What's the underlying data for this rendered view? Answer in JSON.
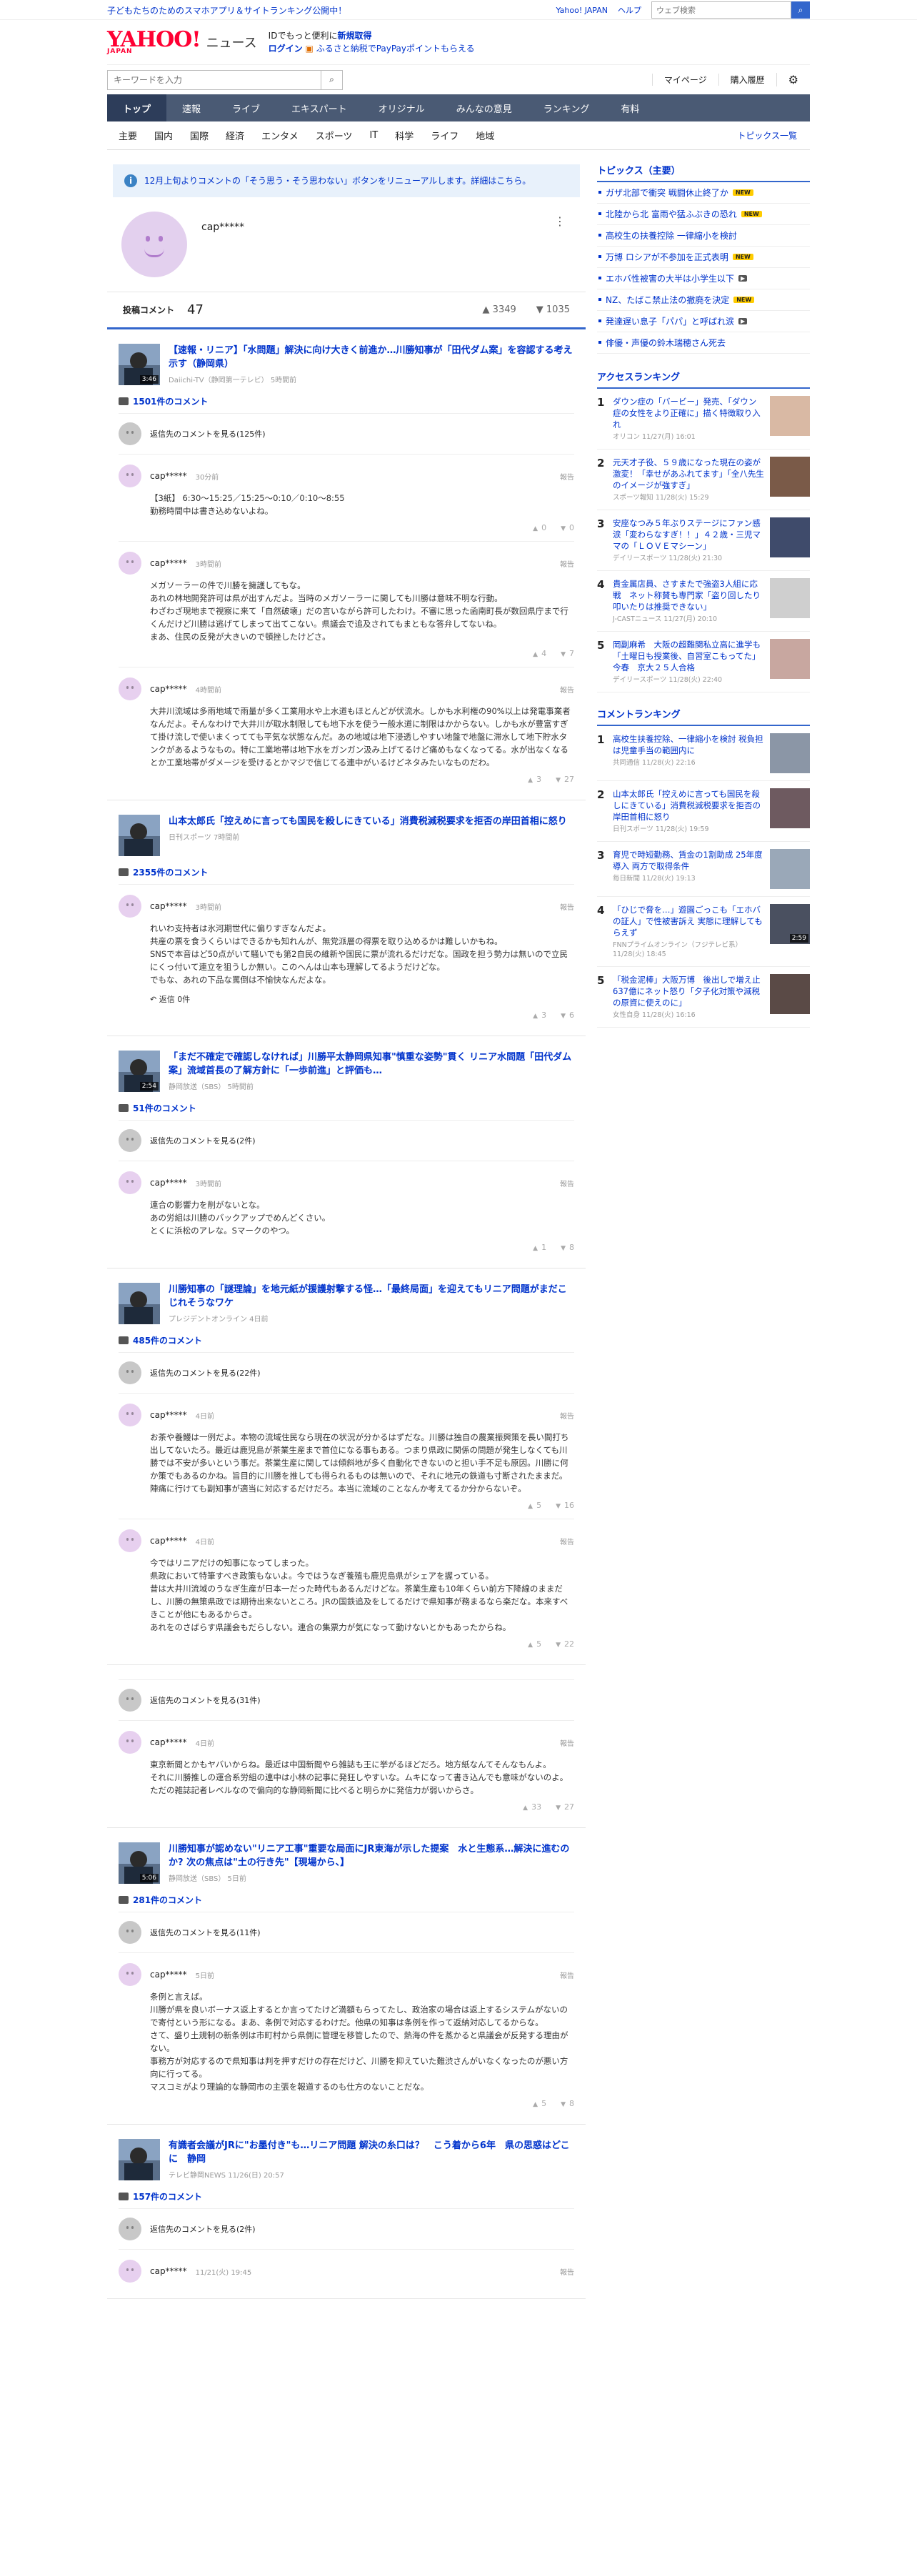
{
  "topbar": {
    "promo": "子どもたちのためのスマホアプリ＆サイトランキング公開中！",
    "links": [
      "Yahoo! JAPAN",
      "ヘルプ"
    ],
    "search_placeholder": "ウェブ検索"
  },
  "header": {
    "logo_main": "YAHOO!",
    "logo_sub": "JAPAN",
    "logo_news": "ニュース",
    "msg1_prefix": "IDでもっと便利に",
    "msg1_link": "新規取得",
    "login": "ログイン",
    "msg2": "ふるさと納税でPayPayポイントもらえる"
  },
  "searchrow": {
    "placeholder": "キーワードを入力",
    "mypage": "マイページ",
    "purchase": "購入履歴"
  },
  "nav": {
    "tabs": [
      "トップ",
      "速報",
      "ライブ",
      "エキスパート",
      "オリジナル",
      "みんなの意見",
      "ランキング",
      "有料"
    ]
  },
  "subnav": {
    "cats": [
      "主要",
      "国内",
      "国際",
      "経済",
      "エンタメ",
      "スポーツ",
      "IT",
      "科学",
      "ライフ",
      "地域"
    ],
    "all": "トピックス一覧"
  },
  "notice": {
    "text": "12月上旬よりコメントの「そう思う・そう思わない」ボタンをリニューアルします。詳細はこちら。"
  },
  "profile": {
    "name": "cap*****",
    "comments_label": "投稿コメント",
    "comments_count": "47",
    "likes": "3349",
    "dislikes": "1035"
  },
  "articles": [
    {
      "title": "【速報・リニア】「水問題」解決に向け大きく前進か…川勝知事が「田代ダム案」を容認する考え示す（静岡県）",
      "source": "Daiichi-TV（静岡第一テレビ） 5時間前",
      "dur": "3:46",
      "ccount": "1501件のコメント",
      "reply_link": "返信先のコメントを見る(125件)",
      "comments": [
        {
          "user": "cap*****",
          "time": "30分前",
          "body": "【3紙】 6:30〜15:25／15:25〜0:10／0:10〜8:55\n勤務時間中は書き込めないよね。",
          "up": "0",
          "down": "0"
        },
        {
          "user": "cap*****",
          "time": "3時間前",
          "body": "メガソーラーの件で川勝を擁護してもな。\nあれの林地開発許可は県が出すんだよ。当時のメガソーラーに関しても川勝は意味不明な行動。\nわざわざ現地まで視察に来て「自然破壊」だの言いながら許可したわけ。不審に思った函南町長が数回県庁まで行くんだけど川勝は逃げてしまって出てこない。県議会で追及されてもまともな答弁してないね。\nまあ、住民の反発が大きいので頓挫したけどさ。",
          "up": "4",
          "down": "7"
        },
        {
          "user": "cap*****",
          "time": "4時間前",
          "body": "大井川流域は多雨地域で雨量が多く工業用水や上水道もほとんどが伏流水。しかも水利権の90%以上は発電事業者なんだよ。そんなわけで大井川が取水制限しても地下水を使う一般水道に制限はかからない。しかも水が豊富すぎて掛け流しで使いまくってても平気な状態なんだ。あの地域は地下浸透しやすい地盤で地盤に滞水して地下貯水タンクがあるようなもの。特に工業地帯は地下水をガンガン汲み上げてるけど痛めもなくなってる。水が出なくなるとか工業地帯がダメージを受けるとかマジで信じてる連中がいるけどネタみたいなものだわ。",
          "up": "3",
          "down": "27"
        }
      ]
    },
    {
      "title": "山本太郎氏「控えめに言っても国民を殺しにきている」消費税減税要求を拒否の岸田首相に怒り",
      "source": "日刊スポーツ 7時間前",
      "dur": "",
      "ccount": "2355件のコメント",
      "reply_link": "",
      "comments": [
        {
          "user": "cap*****",
          "time": "3時間前",
          "body": "れいわ支持者は氷河期世代に偏りすぎなんだよ。\n共産の票を食うくらいはできるかも知れんが、無党派層の得票を取り込めるかは難しいかもね。\nSNSで本音はど50点がいて騒いでも第2自民の維新や国民に票が流れるだけだな。国政を担う勢力は無いので立民にくっ付いて連立を狙うしか無い。このへんは山本も理解してるようだけどな。\nでもな、あれの下品な罵倒は不愉快なんだよな。",
          "up": "3",
          "down": "6",
          "reply": "返信 0件"
        }
      ]
    },
    {
      "title": "「まだ不確定で確認しなければ」川勝平太静岡県知事\"慎重な姿勢\"貫く リニア水問題「田代ダム案」流域首長の了解方針に「一歩前進」と評価も…",
      "source": "静岡放送（SBS） 5時間前",
      "dur": "2:54",
      "ccount": "51件のコメント",
      "reply_link": "返信先のコメントを見る(2件)",
      "comments": [
        {
          "user": "cap*****",
          "time": "3時間前",
          "body": "連合の影響力を削がないとな。\nあの労組は川勝のバックアップでめんどくさい。\nとくに浜松のアレな。Sマークのやつ。",
          "up": "1",
          "down": "8"
        }
      ]
    },
    {
      "title": "川勝知事の「謎理論」を地元紙が援護射撃する怪…「最終局面」を迎えてもリニア問題がまだこじれそうなワケ",
      "source": "プレジデントオンライン 4日前",
      "dur": "",
      "ccount": "485件のコメント",
      "reply_link": "返信先のコメントを見る(22件)",
      "comments": [
        {
          "user": "cap*****",
          "time": "4日前",
          "body": "お茶や養鰻は一例だよ。本物の流域住民なら現在の状況が分かるはずだな。川勝は独自の農業振興策を長い間打ち出してないたろ。最近は鹿児島が茶業生産まで首位になる事もある。つまり県政に関係の問題が発生しなくても川勝では不安が多いという事だ。茶業生産に関しては傾斜地が多く自動化できないのと担い手不足も原因。川勝に何か策でもあるのかね。旨目的に川勝を推しても得られるものは無いので、それに地元の鉄道も寸断されたままだ。陣痛に行けても副知事が適当に対応するだけだろ。本当に流域のことなんか考えてるか分からないぞ。",
          "up": "5",
          "down": "16"
        },
        {
          "user": "cap*****",
          "time": "4日前",
          "body": "今ではリニアだけの知事になってしまった。\n県政において特筆すべき政策もないよ。今ではうなぎ養殖も鹿児島県がシェアを握っている。\n昔は大井川流域のうなぎ生産が日本一だった時代もあるんだけどな。茶業生産も10年くらい前方下降線のままだし、川勝の無策県政では期待出来ないところ。JRの国鉄追及をしてるだけで県知事が務まるなら楽だな。本来すべきことが他にもあるからさ。\nあれをのさばらす県議会もだらしない。連合の集票力が気になって動けないとかもあったからね。",
          "up": "5",
          "down": "22"
        }
      ]
    },
    {
      "title": "",
      "source": "",
      "dur": "",
      "ccount": "",
      "reply_link": "返信先のコメントを見る(31件)",
      "comments": [
        {
          "user": "cap*****",
          "time": "4日前",
          "body": "東京新聞とかもヤバいからね。最近は中国新聞やら雑誌も王に挙がるほどだろ。地方紙なんてそんなもんよ。\nそれに川勝推しの運合系労組の連中は小林の記事に発狂しやすいな。ムキになって書き込んでも意味がないのよ。ただの雑誌記者レベルなので偏向的な静岡新聞に比べると明らかに発信力が弱いからさ。",
          "up": "33",
          "down": "27"
        }
      ]
    },
    {
      "title": "川勝知事が認めない\"リニア工事\"重要な局面にJR東海が示した提案　水と生態系…解決に進むのか? 次の焦点は\"土の行き先\"【現場から、】",
      "source": "静岡放送（SBS） 5日前",
      "dur": "5:06",
      "ccount": "281件のコメント",
      "reply_link": "返信先のコメントを見る(11件)",
      "comments": [
        {
          "user": "cap*****",
          "time": "5日前",
          "body": "条例と言えば。\n川勝が県を良いボーナス返上するとか言ってたけど満額もらってたし、政治家の場合は返上するシステムがないので寄付という形になる。まあ、条例で対応するわけだ。他県の知事は条例を作って返納対応してるからな。\nさて、盛り土規制の新条例は市町村から県側に管理を移管したので、熱海の件を蒸かると県議会が反発する理由がない。\n事務方が対応するので県知事は判を押すだけの存在だけど、川勝を抑えていた難渋さんがいなくなったのが悪い方向に行ってる。\nマスコミがより理論的な静岡市の主張を報道するのも仕方のないことだな。",
          "up": "5",
          "down": "8"
        }
      ]
    },
    {
      "title": "有識者会議がJRに\"お墨付き\"も…リニア問題 解決の糸口は？　こう着から6年　県の思惑はどこに　静岡",
      "source": "テレビ静岡NEWS 11/26(日) 20:57",
      "dur": "",
      "ccount": "157件のコメント",
      "reply_link": "返信先のコメントを見る(2件)",
      "comments": [
        {
          "user": "cap*****",
          "time": "11/21(火) 19:45",
          "body": "",
          "up": "",
          "down": ""
        }
      ]
    }
  ],
  "sidebar": {
    "topics_title": "トピックス（主要）",
    "topics": [
      {
        "label": "ガザ北部で衝突 戦闘休止終了か",
        "badge": "new"
      },
      {
        "label": "北陸から北 富雨や猛ふぶきの恐れ",
        "badge": "new"
      },
      {
        "label": "高校生の扶養控除 一律縮小を検討",
        "badge": ""
      },
      {
        "label": "万博 ロシアが不参加を正式表明",
        "badge": "new"
      },
      {
        "label": "エホバ性被害の大半は小学生以下",
        "badge": "video"
      },
      {
        "label": "NZ、たばこ禁止法の撤廃を決定",
        "badge": "new"
      },
      {
        "label": "発達遅い息子「パパ」と呼ばれ涙",
        "badge": "video"
      },
      {
        "label": "俳優・声優の鈴木瑞穂さん死去",
        "badge": ""
      }
    ],
    "access_title": "アクセスランキング",
    "access": [
      {
        "n": "1",
        "title": "ダウン症の「バービー」発売、「ダウン症の女性をより正確に」描く特徴取り入れ",
        "src": "オリコン 11/27(月) 16:01",
        "dur": ""
      },
      {
        "n": "2",
        "title": "元天才子役、５９歳になった現在の姿が激変！「幸せがあふれてます」「全八先生のイメージが強すぎ」",
        "src": "スポーツ報知 11/28(火) 15:29",
        "dur": ""
      },
      {
        "n": "3",
        "title": "安座なつみ５年ぶりステージにファン感涙「変わらなすぎ！！」４２歳・三児ママの「ＬＯＶＥマシーン」",
        "src": "デイリースポーツ 11/28(火) 21:30",
        "dur": ""
      },
      {
        "n": "4",
        "title": "貴金属店員、さすまたで強盗3人組に応戦　ネット称賛も専門家「盗り回したり叩いたりは推奨できない」",
        "src": "J-CASTニュース 11/27(月) 20:10",
        "dur": ""
      },
      {
        "n": "5",
        "title": "岡副麻希　大阪の超難関私立高に進学も「土曜日も授業後、自習室こもってた」今春　京大２５人合格",
        "src": "デイリースポーツ 11/28(火) 22:40",
        "dur": ""
      }
    ],
    "comment_title": "コメントランキング",
    "comment_rank": [
      {
        "n": "1",
        "title": "高校生扶養控除、一律縮小を検討 税負担は児童手当の範囲内に",
        "src": "共同通信 11/28(火) 22:16",
        "dur": ""
      },
      {
        "n": "2",
        "title": "山本太郎氏「控えめに言っても国民を殺しにきている」消費税減税要求を拒否の岸田首相に怒り",
        "src": "日刊スポーツ 11/28(火) 19:59",
        "dur": ""
      },
      {
        "n": "3",
        "title": "育児で時短勤務、賃金の1割助成 25年度導入 両方で取得条件",
        "src": "毎日新聞 11/28(火) 19:13",
        "dur": ""
      },
      {
        "n": "4",
        "title": "「ひじで脅を…」遊園ごっこも「エホバの証人」で性被害訴え 実態に理解してもらえず",
        "src": "FNNプライムオンライン（フジテレビ系） 11/28(火) 18:45",
        "dur": "2:59"
      },
      {
        "n": "5",
        "title": "「税金泥棒」大阪万博　後出しで増え止637億にネット怒り「夕子化対策や減税の原資に使えのに」",
        "src": "女性自身 11/28(火) 16:16",
        "dur": ""
      }
    ]
  },
  "colors": {
    "brand": "#ff0033",
    "link": "#0033cc",
    "nav": "#4a5a74",
    "accent": "#3366cc"
  },
  "icons": [
    "search-icon",
    "gear-icon",
    "info-icon",
    "more-icon",
    "comment-icon",
    "thumb-up-icon",
    "thumb-down-icon",
    "reply-icon",
    "coupon-icon"
  ]
}
